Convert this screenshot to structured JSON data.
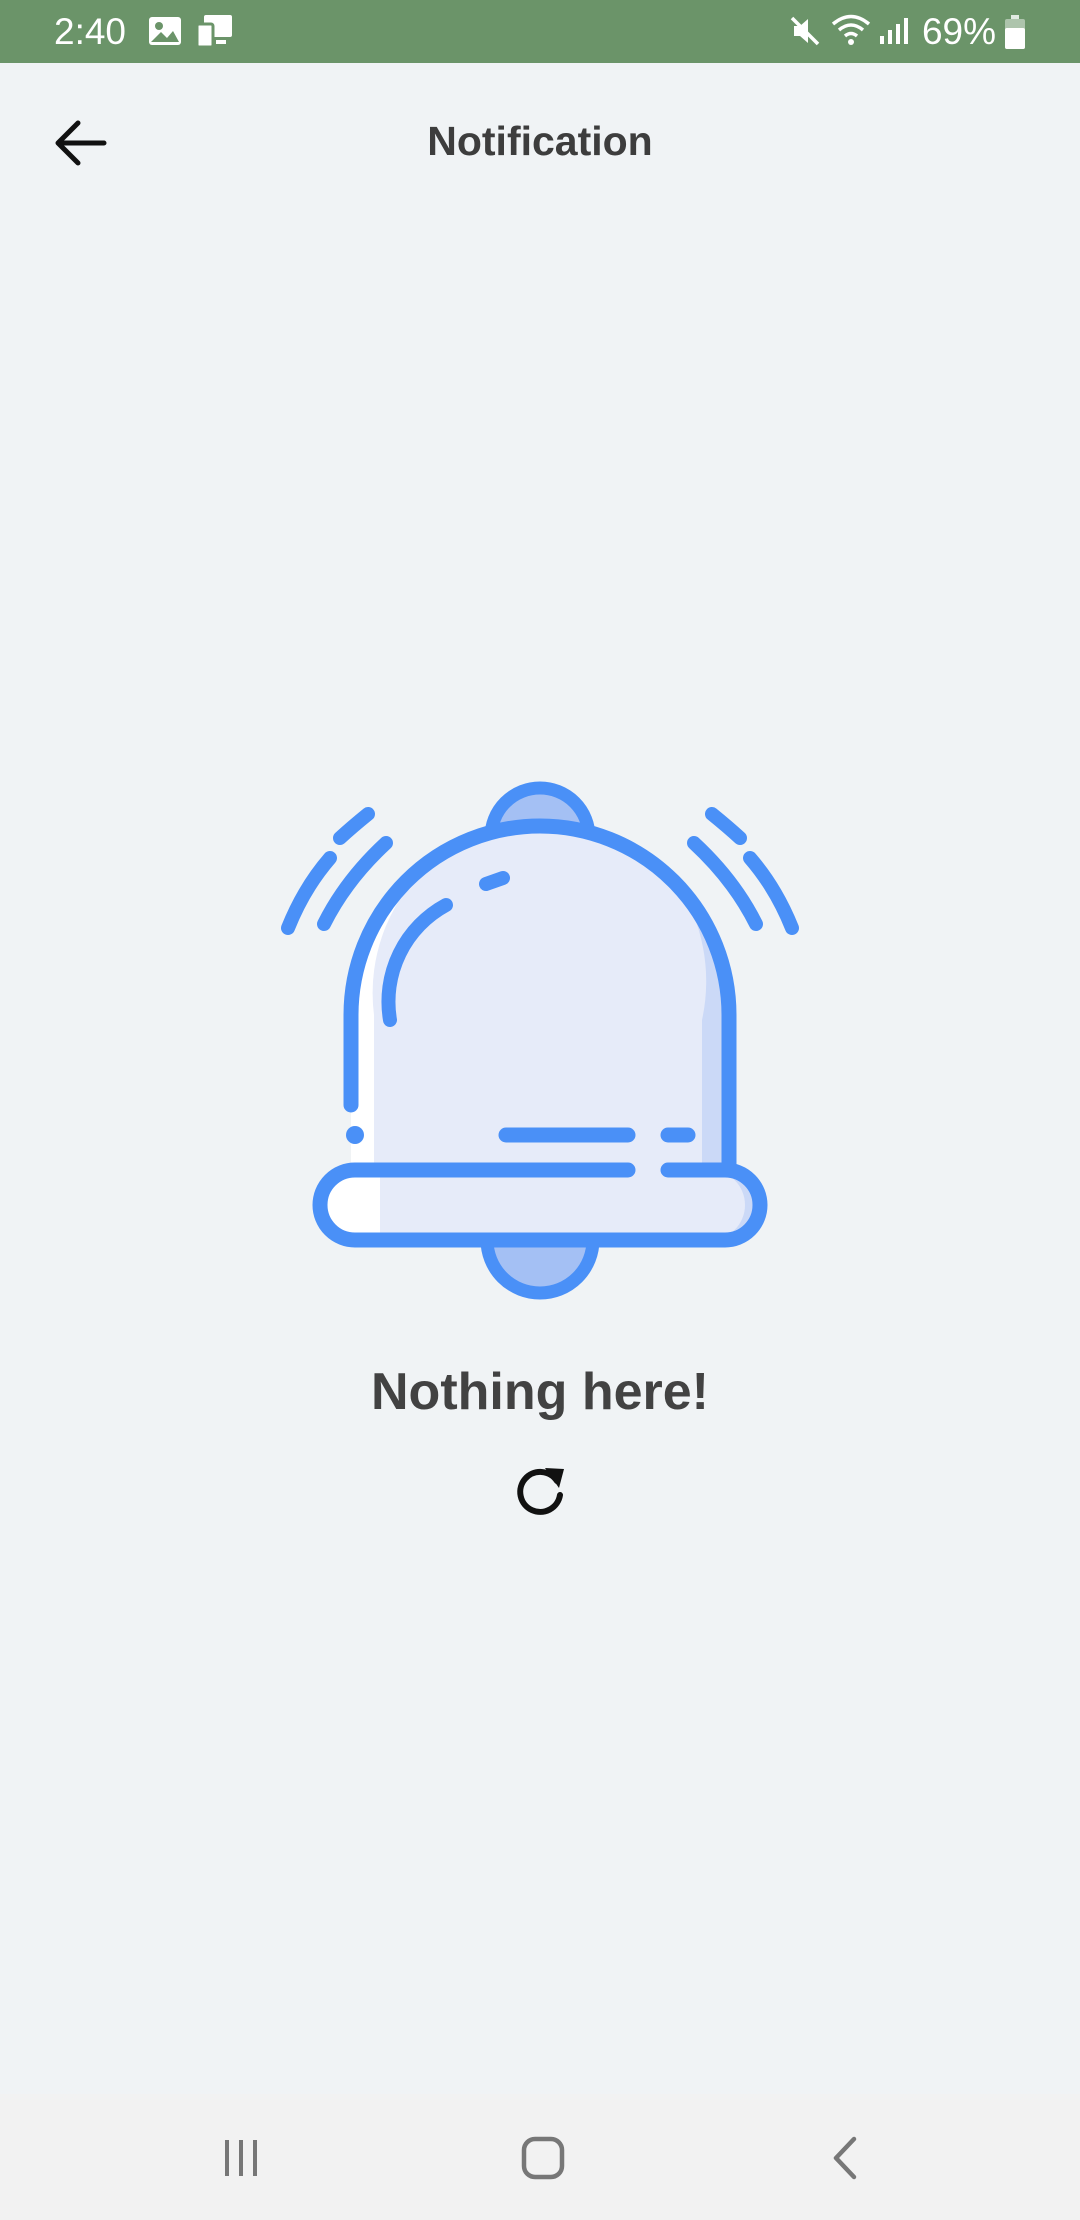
{
  "status_bar": {
    "time": "2:40",
    "battery": "69%",
    "icons": [
      "gallery-icon",
      "screen-mirror-icon",
      "mute-icon",
      "wifi-icon",
      "signal-icon",
      "battery-icon"
    ],
    "background_color": "#6b9469"
  },
  "header": {
    "title": "Notification",
    "back_icon": "arrow-left-icon"
  },
  "empty_state": {
    "illustration": "bell-icon",
    "message": "Nothing here!",
    "refresh_icon": "refresh-icon",
    "accent_color": "#4a90f7"
  },
  "nav_bar": {
    "buttons": [
      "recents-button",
      "home-button",
      "back-button"
    ]
  }
}
